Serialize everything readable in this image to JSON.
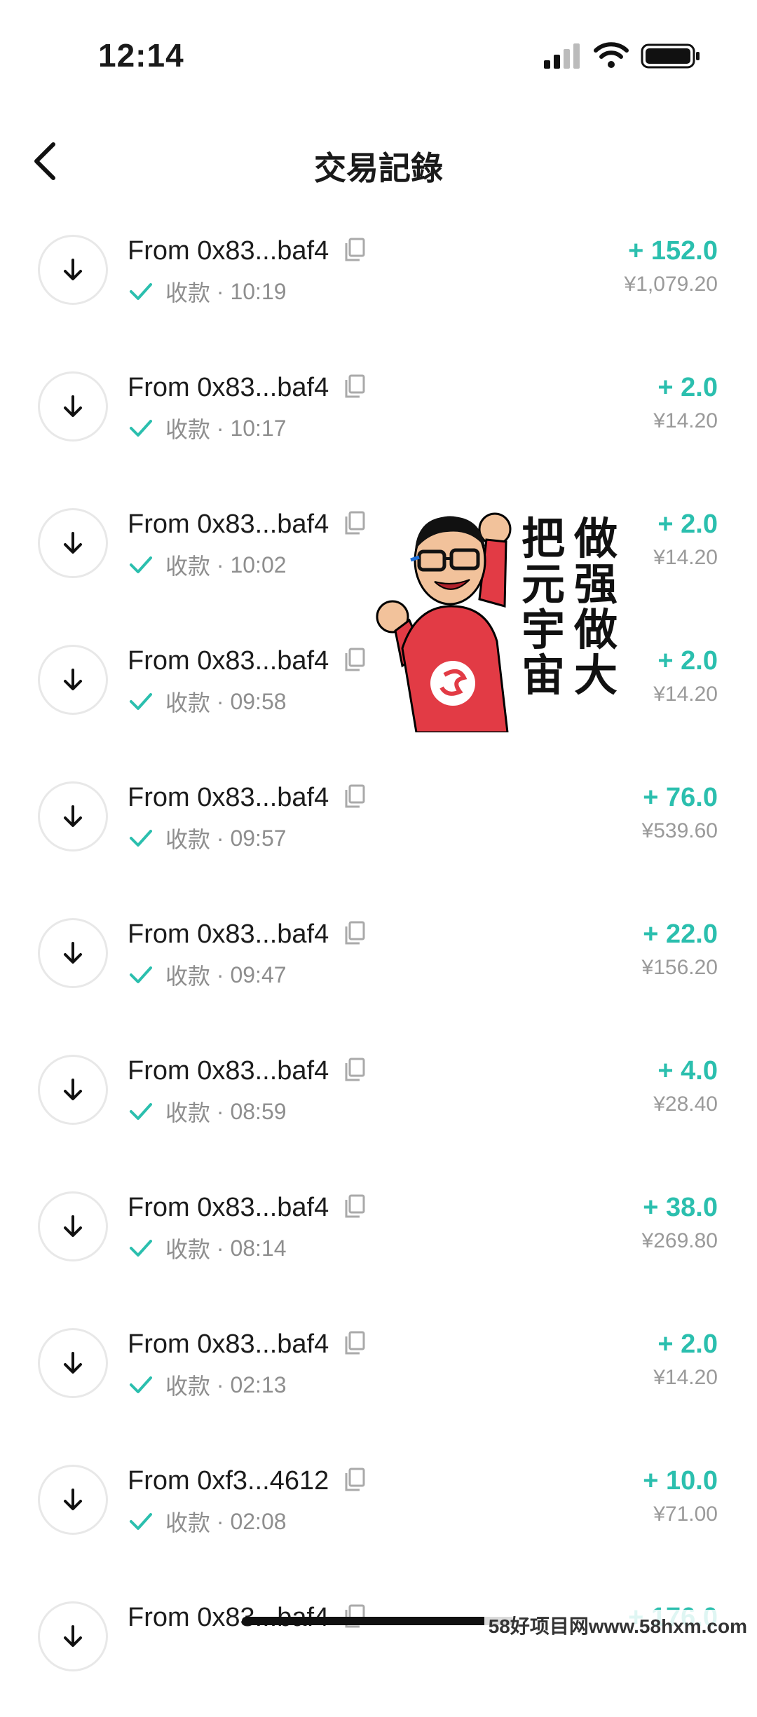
{
  "status_bar": {
    "time": "12:14"
  },
  "nav": {
    "title": "交易記錄"
  },
  "transactions": [
    {
      "from": "From 0x83...baf4",
      "status": "收款",
      "time": "· 10:19",
      "amount": "+ 152.0",
      "fiat": "¥1,079.20"
    },
    {
      "from": "From 0x83...baf4",
      "status": "收款",
      "time": "· 10:17",
      "amount": "+ 2.0",
      "fiat": "¥14.20"
    },
    {
      "from": "From 0x83...baf4",
      "status": "收款",
      "time": "· 10:02",
      "amount": "+ 2.0",
      "fiat": "¥14.20"
    },
    {
      "from": "From 0x83...baf4",
      "status": "收款",
      "time": "· 09:58",
      "amount": "+ 2.0",
      "fiat": "¥14.20"
    },
    {
      "from": "From 0x83...baf4",
      "status": "收款",
      "time": "· 09:57",
      "amount": "+ 76.0",
      "fiat": "¥539.60"
    },
    {
      "from": "From 0x83...baf4",
      "status": "收款",
      "time": "· 09:47",
      "amount": "+ 22.0",
      "fiat": "¥156.20"
    },
    {
      "from": "From 0x83...baf4",
      "status": "收款",
      "time": "· 08:59",
      "amount": "+ 4.0",
      "fiat": "¥28.40"
    },
    {
      "from": "From 0x83...baf4",
      "status": "收款",
      "time": "· 08:14",
      "amount": "+ 38.0",
      "fiat": "¥269.80"
    },
    {
      "from": "From 0x83...baf4",
      "status": "收款",
      "time": "· 02:13",
      "amount": "+ 2.0",
      "fiat": "¥14.20"
    },
    {
      "from": "From 0xf3...4612",
      "status": "收款",
      "time": "· 02:08",
      "amount": "+ 10.0",
      "fiat": "¥71.00"
    },
    {
      "from": "From 0x83...baf4",
      "status": "",
      "time": "",
      "amount": "+ 176.0",
      "fiat": ""
    }
  ],
  "sticker": {
    "lines": [
      "把",
      "元",
      "宇",
      "宙",
      "做",
      "强",
      "做",
      "大"
    ]
  },
  "watermark": "58好项目网www.58hxm.com",
  "colors": {
    "accent": "#2bbfae",
    "secondary_text": "#8e8e8e"
  },
  "icons": {
    "row_icon": "arrow-down-icon",
    "copy": "copy-icon",
    "status": "check-icon"
  }
}
